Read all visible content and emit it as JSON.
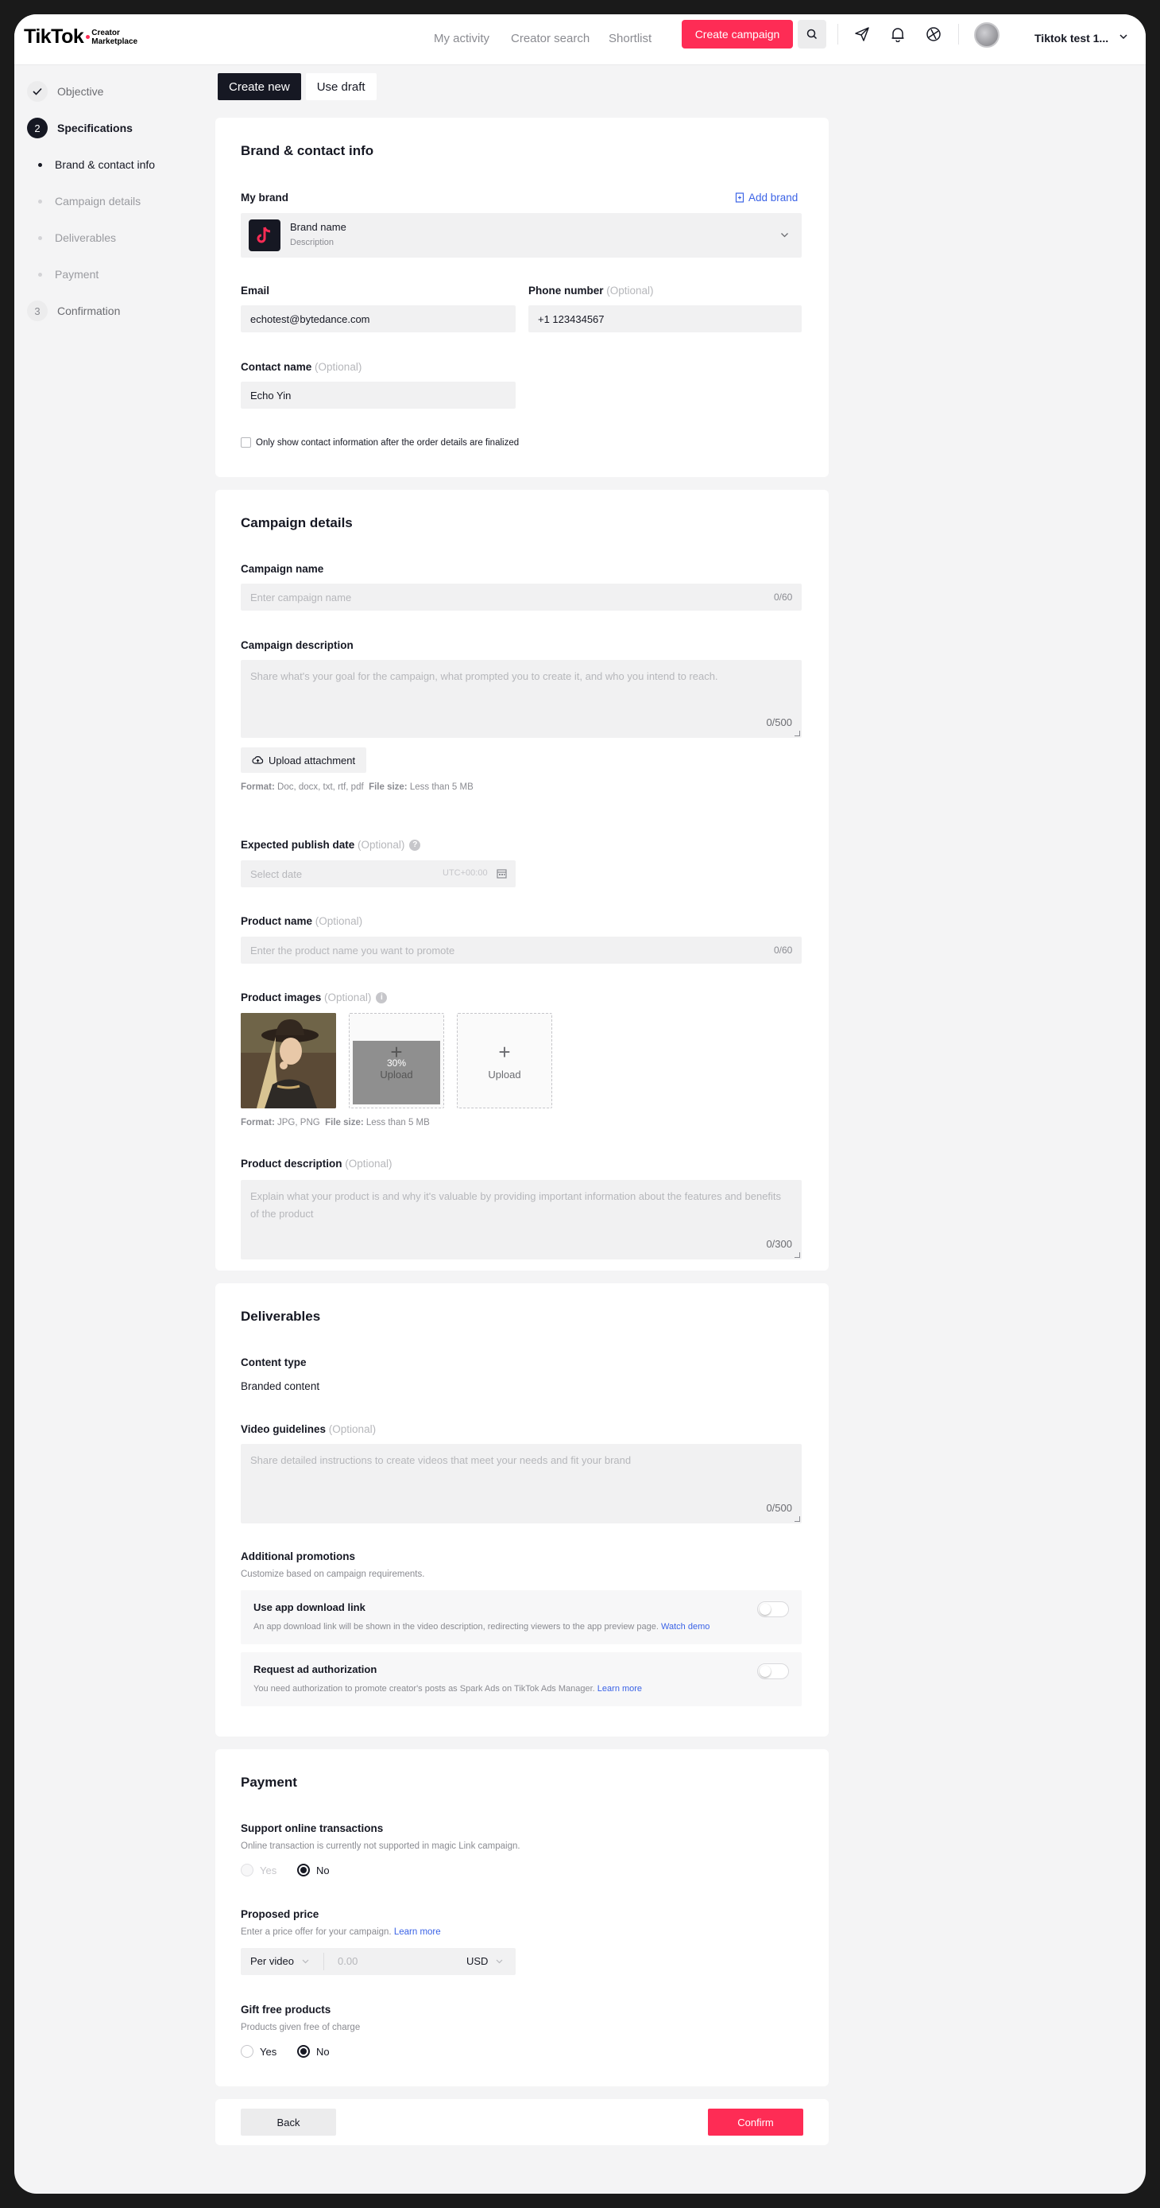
{
  "nav": {
    "logo_main": "TikTok",
    "logo_sub1": "Creator",
    "logo_sub2": "Marketplace",
    "links": [
      "My activity",
      "Creator search",
      "Shortlist"
    ],
    "create_button": "Create campaign",
    "username": "Tiktok test 1..."
  },
  "sidebar": {
    "steps": [
      {
        "label": "Objective",
        "state": "done"
      },
      {
        "number": "2",
        "label": "Specifications",
        "state": "active"
      },
      {
        "number": "3",
        "label": "Confirmation",
        "state": "pending"
      }
    ],
    "substeps": [
      "Brand & contact info",
      "Campaign details",
      "Deliverables",
      "Payment"
    ]
  },
  "tabs": [
    "Create new",
    "Use draft"
  ],
  "brand": {
    "title": "Brand & contact info",
    "my_brand_label": "My brand",
    "add_brand": "Add brand",
    "brand_name": "Brand name",
    "brand_desc": "Description",
    "email_label": "Email",
    "email_value": "echotest@bytedance.com",
    "phone_label": "Phone number",
    "optional": "(Optional)",
    "phone_value": "+1 123434567",
    "contact_label": "Contact name",
    "contact_value": "Echo Yin",
    "checkbox_label": "Only show contact information after the order details are finalized"
  },
  "campaign": {
    "title": "Campaign details",
    "name_label": "Campaign name",
    "name_placeholder": "Enter campaign name",
    "name_counter": "0/60",
    "desc_label": "Campaign description",
    "desc_placeholder": "Share what's your goal for the campaign, what prompted you to create it, and who you intend to reach.",
    "desc_counter": "0/500",
    "upload_attachment": "Upload attachment",
    "attach_format_label": "Format:",
    "attach_format": "Doc, docx, txt, rtf, pdf",
    "size_label": "File size:",
    "size_value": "Less than 5 MB",
    "date_label": "Expected publish date",
    "date_placeholder": "Select date",
    "timezone": "UTC+00:00",
    "product_name_label": "Product name",
    "product_name_placeholder": "Enter the product name you want to promote",
    "product_name_counter": "0/60",
    "images_label": "Product images",
    "upload_progress": "30%",
    "upload_label": "Upload",
    "image_format": "JPG, PNG",
    "product_desc_label": "Product description",
    "product_desc_placeholder": "Explain what your product is and why it's valuable by providing important information about the features and benefits of the product",
    "product_desc_counter": "0/300"
  },
  "deliverables": {
    "title": "Deliverables",
    "content_type_label": "Content type",
    "content_type_value": "Branded content",
    "guidelines_label": "Video guidelines",
    "guidelines_placeholder": "Share detailed instructions to create videos that meet your needs and fit your brand",
    "guidelines_counter": "0/500",
    "promotions_label": "Additional promotions",
    "promotions_hint": "Customize based on campaign requirements.",
    "promo1_title": "Use app download link",
    "promo1_desc": "An app download link will be shown in the video description, redirecting viewers to the app preview page.",
    "promo1_link": "Watch demo",
    "promo2_title": "Request ad authorization",
    "promo2_desc": "You need authorization to promote creator's posts as Spark Ads on TikTok Ads Manager.",
    "promo2_link": "Learn more"
  },
  "payment": {
    "title": "Payment",
    "online_label": "Support online transactions",
    "online_hint": "Online transaction is currently not supported in magic Link campaign.",
    "yes": "Yes",
    "no": "No",
    "price_label": "Proposed price",
    "price_hint": "Enter a price offer for your campaign.",
    "price_link": "Learn more",
    "per_video": "Per video",
    "price_placeholder": "0.00",
    "currency": "USD",
    "gift_label": "Gift free products",
    "gift_hint": "Products given free of charge"
  },
  "footer": {
    "back": "Back",
    "confirm": "Confirm"
  },
  "colors": {
    "accent": "#fe2c55",
    "link": "#3b63e6",
    "dark": "#161823"
  }
}
